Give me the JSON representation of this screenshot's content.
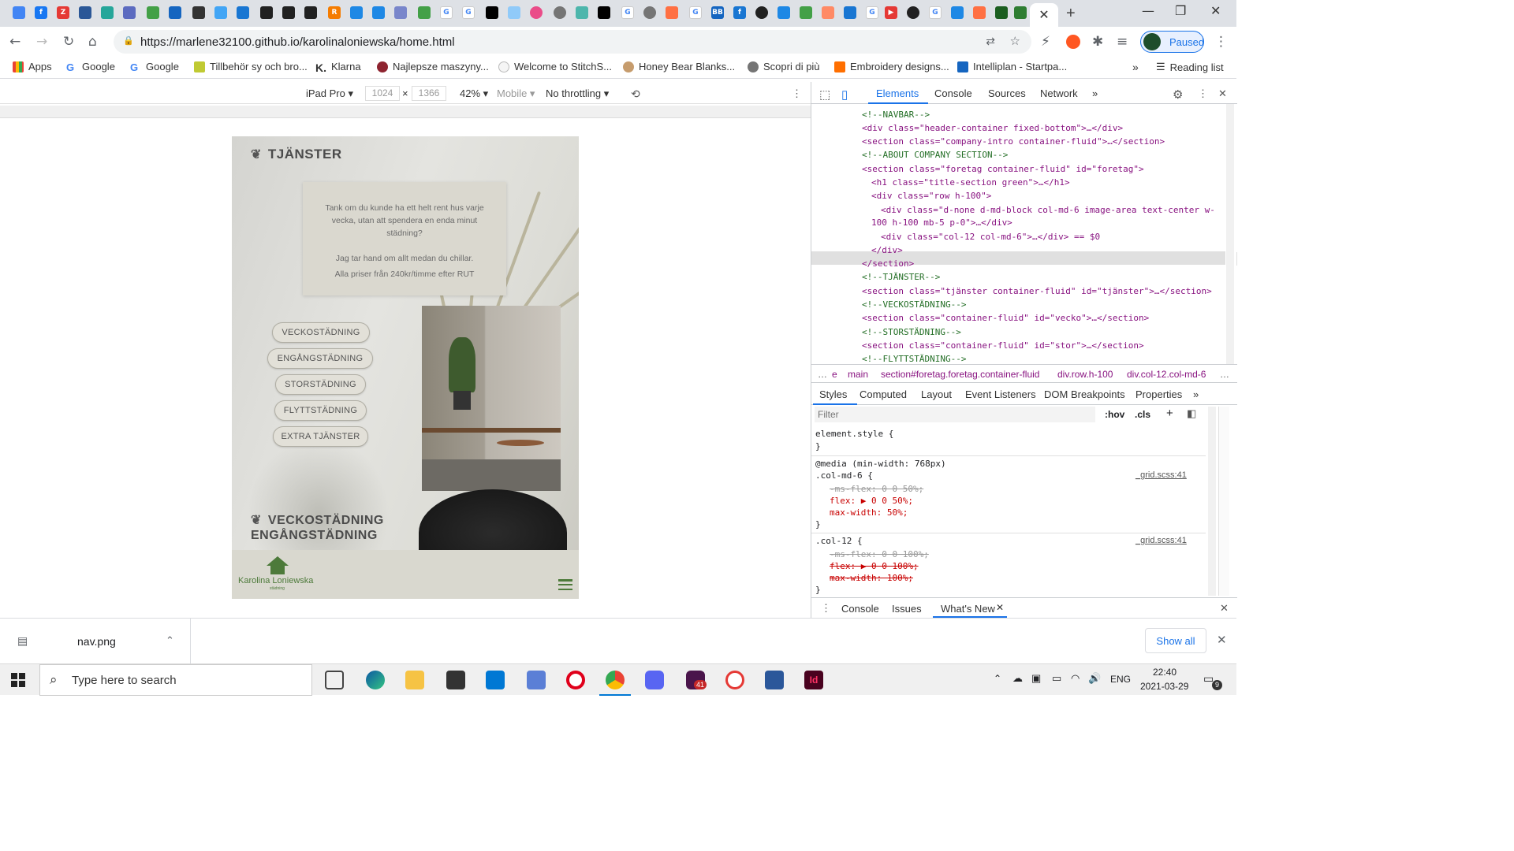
{
  "browser": {
    "url": "https://marlene32100.github.io/karolinaloniewska/home.html",
    "profile_status": "Paused",
    "tab_close": "✕",
    "new_tab": "+",
    "reading_list": "Reading list",
    "bookmarks_overflow": "»",
    "bookmarks": [
      {
        "label": "Apps"
      },
      {
        "label": "Google"
      },
      {
        "label": "Google"
      },
      {
        "label": "Tillbehör sy och bro..."
      },
      {
        "label": "Klarna"
      },
      {
        "label": "Najlepsze maszyny..."
      },
      {
        "label": "Welcome to StitchS..."
      },
      {
        "label": "Honey Bear Blanks..."
      },
      {
        "label": "Scopri di più"
      },
      {
        "label": "Embroidery designs..."
      },
      {
        "label": "Intelliplan - Startpa..."
      }
    ]
  },
  "device_toolbar": {
    "device": "iPad Pro ▾",
    "width": "1024",
    "height": "1366",
    "times": "×",
    "zoom": "42% ▾",
    "mode": "Mobile ▾",
    "throttling": "No throttling ▾"
  },
  "site": {
    "section_title": "TJÄNSTER",
    "intro_line1": "Tank om du kunde ha ett helt rent hus varje vecka, utan att spendera en enda minut städning?",
    "intro_line2": "Jag tar hand om allt medan du chillar.",
    "intro_line3": "Alla priser från 240kr/timme efter RUT",
    "services": [
      "VECKOSTÄDNING",
      "ENGÅNGSTÄDNING",
      "STORSTÄDNING",
      "FLYTTSTÄDNING",
      "EXTRA TJÄNSTER"
    ],
    "heading2_line1": "VECKOSTÄDNING",
    "heading2_line2": "ENGÅNGSTÄDNING",
    "logo_name": "Karolina Loniewska",
    "logo_sub": "städning"
  },
  "devtools": {
    "tabs": [
      "Elements",
      "Console",
      "Sources",
      "Network",
      "»"
    ],
    "dom_lines": [
      "<!--NAVBAR-->",
      "<div class=\"header-container fixed-bottom\">…</div>",
      "<section class=\"company-intro container-fluid\">…</section>",
      "<!--ABOUT COMPANY SECTION-->",
      "<section class=\"foretag container-fluid\" id=\"foretag\">",
      "<h1 class=\"title-section green\">…</h1>",
      "<div class=\"row h-100\">",
      "<div class=\"d-none d-md-block col-md-6 image-area text-center w-",
      "100 h-100 mb-5 p-0\">…</div>",
      "<div class=\"col-12 col-md-6\">…</div> == $0",
      "</div>",
      "</section>",
      "<!--TJÄNSTER-->",
      "<section class=\"tjänster container-fluid\" id=\"tjänster\">…</section>",
      "<!--VECKOSTÄDNING-->",
      "<section class=\"container-fluid\" id=\"vecko\">…</section>",
      "<!--STORSTÄDNING-->",
      "<section class=\"container-fluid\" id=\"stor\">…</section>",
      "<!--FLYTTSTÄDNING-->"
    ],
    "breadcrumbs": [
      "…",
      "e",
      "main",
      "section#foretag.foretag.container-fluid",
      "div.row.h-100",
      "div.col-12.col-md-6",
      "…"
    ],
    "style_tabs": [
      "Styles",
      "Computed",
      "Layout",
      "Event Listeners",
      "DOM Breakpoints",
      "Properties",
      "»"
    ],
    "filter_placeholder": "Filter",
    "hov": ":hov",
    "cls": ".cls",
    "style_rules": [
      "element.style {",
      "}",
      "@media (min-width: 768px)",
      ".col-md-6 {",
      "-ms-flex: 0 0 50%;",
      "flex: ▶ 0 0 50%;",
      "max-width: 50%;",
      "}",
      ".col-12 {",
      "-ms-flex: 0 0 100%;",
      "flex: ▶ 0 0 100%;",
      "max-width: 100%;",
      "}"
    ],
    "source_link": "_grid.scss:41",
    "drawer_tabs": [
      "Console",
      "Issues",
      "What's New"
    ],
    "drawer_close": "✕"
  },
  "downloads": {
    "file": "nav.png",
    "show_all": "Show all"
  },
  "taskbar": {
    "search_placeholder": "Type here to search",
    "language": "ENG",
    "time": "22:40",
    "date": "2021-03-29",
    "notifications": "9",
    "slack_badge": "41"
  }
}
